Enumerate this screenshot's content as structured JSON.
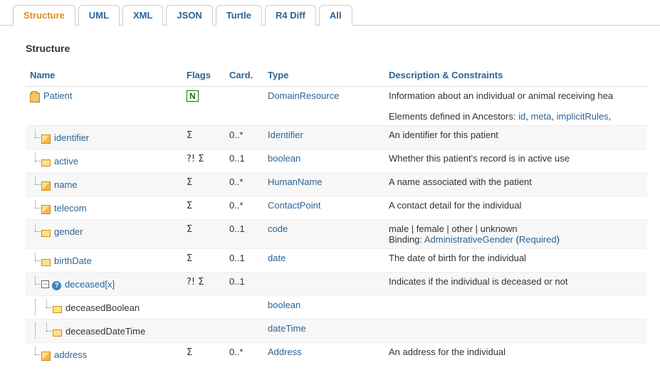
{
  "tabs": [
    "Structure",
    "UML",
    "XML",
    "JSON",
    "Turtle",
    "R4 Diff",
    "All"
  ],
  "active_tab": 0,
  "heading": "Structure",
  "columns": [
    "Name",
    "Flags",
    "Card.",
    "Type",
    "Description & Constraints"
  ],
  "ancestors_prefix": "Elements defined in Ancestors: ",
  "ancestors": [
    "id",
    "meta",
    "implicitRules"
  ],
  "binding_label": "Binding:",
  "rows": [
    {
      "depth": 0,
      "kind": "folder",
      "name": "Patient",
      "is_link": true,
      "flag_n": true,
      "flags": "",
      "card": "",
      "type": "DomainResource",
      "desc": "Information about an individual or animal receiving hea",
      "show_ancestors": true,
      "toggle": null
    },
    {
      "depth": 1,
      "kind": "cube",
      "name": "identifier",
      "is_link": true,
      "flags": "Σ",
      "card": "0..*",
      "type": "Identifier",
      "desc": "An identifier for this patient"
    },
    {
      "depth": 1,
      "kind": "prim",
      "name": "active",
      "is_link": true,
      "flags": "?! Σ",
      "card": "0..1",
      "type": "boolean",
      "desc": "Whether this patient's record is in active use"
    },
    {
      "depth": 1,
      "kind": "cube",
      "name": "name",
      "is_link": true,
      "flags": "Σ",
      "card": "0..*",
      "type": "HumanName",
      "desc": "A name associated with the patient"
    },
    {
      "depth": 1,
      "kind": "cube",
      "name": "telecom",
      "is_link": true,
      "flags": "Σ",
      "card": "0..*",
      "type": "ContactPoint",
      "desc": "A contact detail for the individual"
    },
    {
      "depth": 1,
      "kind": "prim",
      "name": "gender",
      "is_link": true,
      "flags": "Σ",
      "card": "0..1",
      "type": "code",
      "desc": "male | female | other | unknown",
      "binding_name": "AdministrativeGender",
      "binding_strength": "Required"
    },
    {
      "depth": 1,
      "kind": "prim",
      "name": "birthDate",
      "is_link": true,
      "flags": "Σ",
      "card": "0..1",
      "type": "date",
      "desc": "The date of birth for the individual"
    },
    {
      "depth": 1,
      "kind": "choice",
      "name": "deceased[x]",
      "is_link": true,
      "flags": "?! Σ",
      "card": "0..1",
      "type": "",
      "desc": "Indicates if the individual is deceased or not",
      "toggle": "minus"
    },
    {
      "depth": 2,
      "kind": "prim",
      "name": "deceasedBoolean",
      "is_link": false,
      "flags": "",
      "card": "",
      "type": "boolean",
      "desc": ""
    },
    {
      "depth": 2,
      "kind": "prim",
      "name": "deceasedDateTime",
      "is_link": false,
      "flags": "",
      "card": "",
      "type": "dateTime",
      "desc": ""
    },
    {
      "depth": 1,
      "kind": "cube",
      "name": "address",
      "is_link": true,
      "flags": "Σ",
      "card": "0..*",
      "type": "Address",
      "desc": "An address for the individual"
    }
  ]
}
